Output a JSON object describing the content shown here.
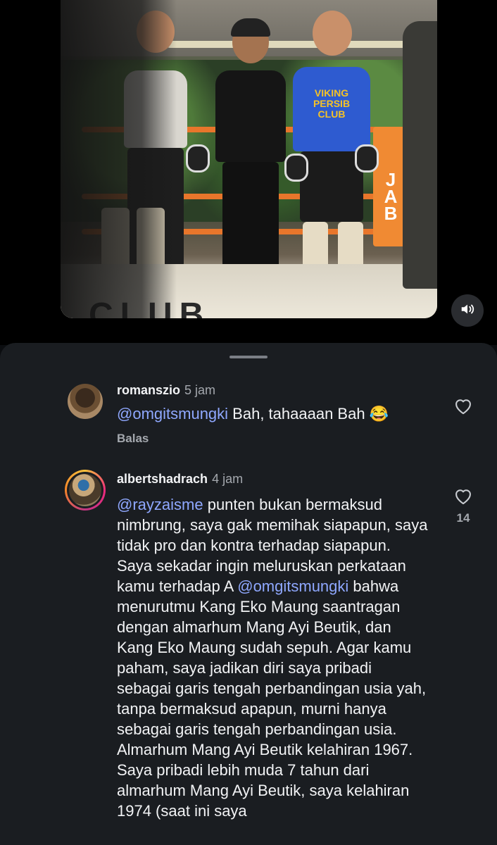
{
  "video": {
    "scene_text": {
      "jersey": "VIKING\nPERSIB CLUB",
      "corner_pad": "JAB",
      "floor": "CLUB"
    }
  },
  "sound_button": {
    "icon": "speaker-volume-icon"
  },
  "comments": [
    {
      "username": "romanszio",
      "time": "5 jam",
      "mention": "@omgitsmungki",
      "text": " Bah, tahaaaan Bah 😂",
      "reply_label": "Balas",
      "like_icon": "heart-outline-icon",
      "like_count": ""
    },
    {
      "username": "albertshadrach",
      "time": "4 jam",
      "mention": "@rayzaisme",
      "text_part1": " punten bukan bermaksud nimbrung, saya gak memihak siapapun, saya tidak pro dan kontra terhadap siapapun. Saya sekadar ingin meluruskan perkataan kamu terhadap A ",
      "mention2": "@omgitsmungki",
      "text_part2": " bahwa menurutmu Kang Eko Maung saantragan dengan almarhum Mang Ayi Beutik, dan Kang Eko Maung sudah sepuh. Agar kamu paham, saya jadikan diri saya pribadi sebagai garis tengah perbandingan usia yah, tanpa bermaksud apapun, murni hanya sebagai garis tengah perbandingan usia. Almarhum Mang Ayi Beutik kelahiran 1967. Saya pribadi lebih muda 7 tahun dari almarhum Mang Ayi Beutik, saya kelahiran 1974 (saat ini saya",
      "like_icon": "heart-outline-icon",
      "like_count": "14"
    }
  ]
}
